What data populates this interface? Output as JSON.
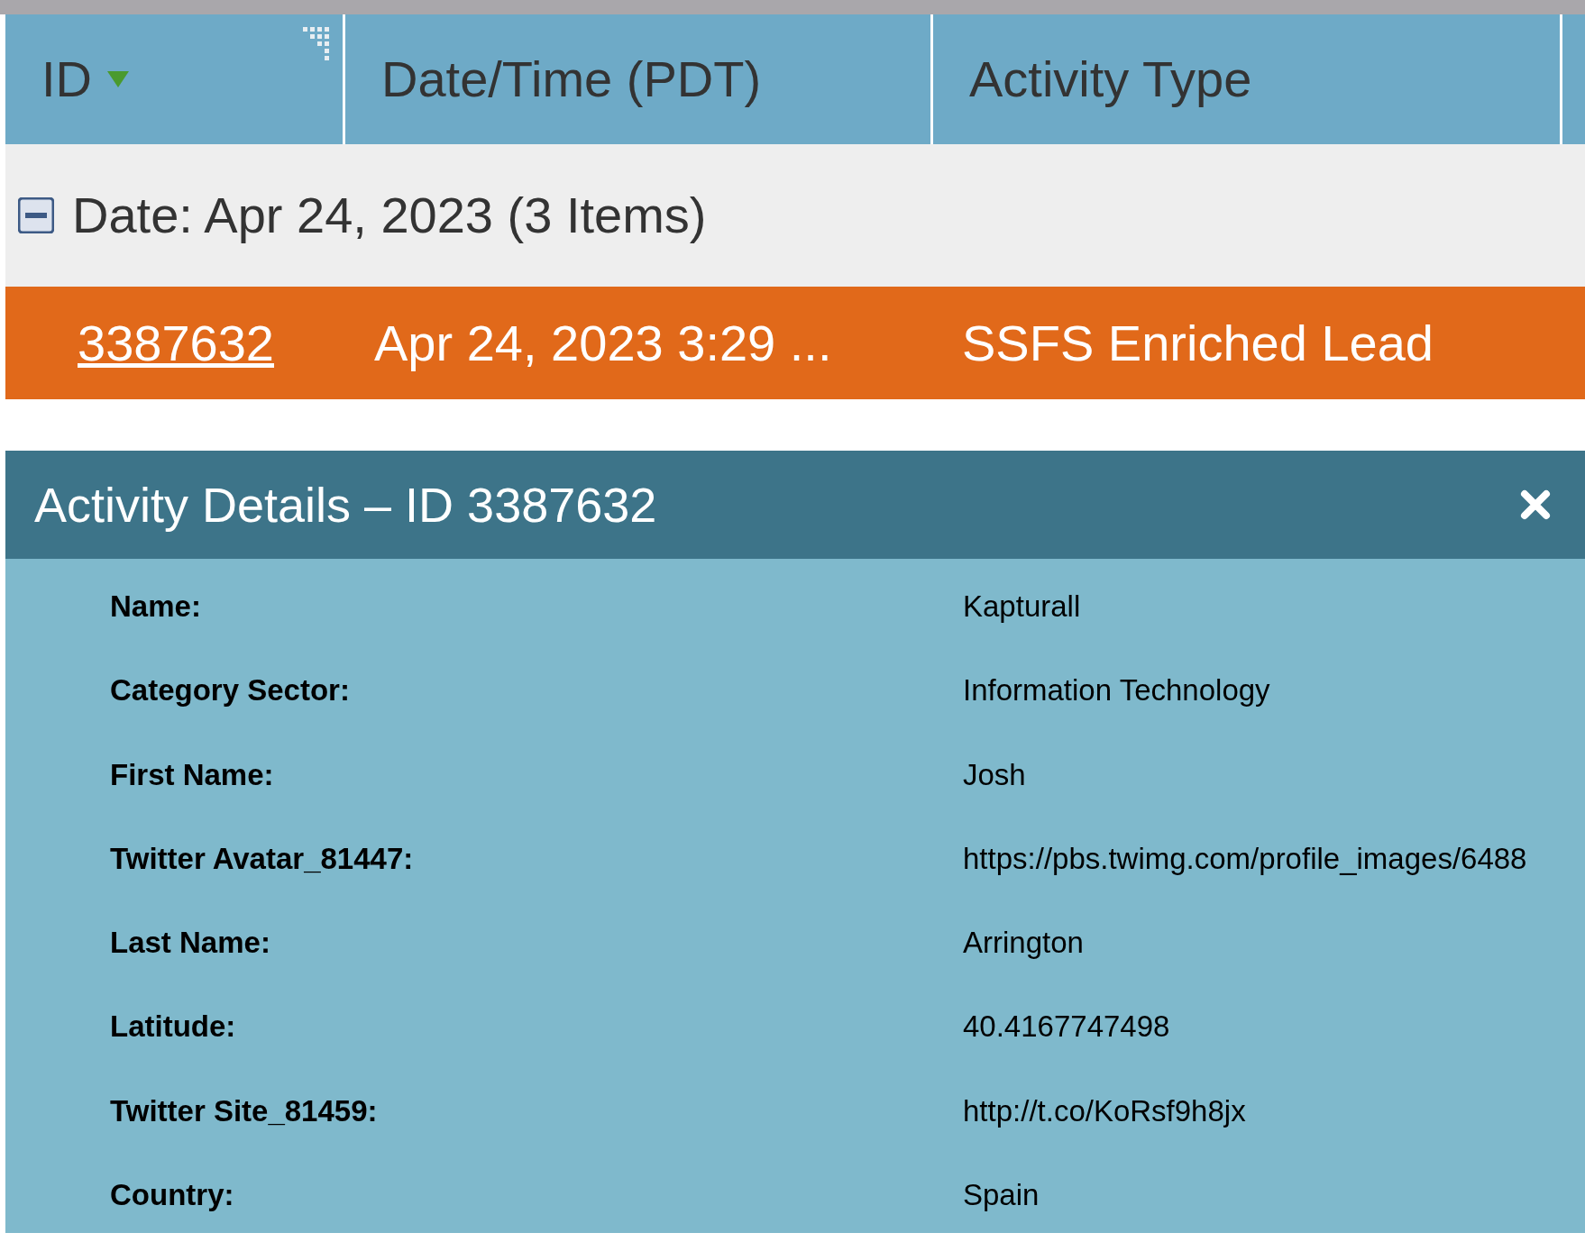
{
  "grid": {
    "columns": [
      {
        "label": "ID",
        "sorted": true,
        "menu": true
      },
      {
        "label": "Date/Time (PDT)",
        "sorted": false,
        "menu": false
      },
      {
        "label": "Activity Type",
        "sorted": false,
        "menu": false
      }
    ],
    "group": {
      "label": "Date: Apr 24, 2023 (3 Items)",
      "expanded": true
    },
    "rows": [
      {
        "selected": true,
        "cells": [
          "3387632",
          "Apr 24, 2023 3:29 ...",
          "SSFS Enriched Lead"
        ]
      }
    ]
  },
  "details": {
    "title": "Activity Details – ID 3387632",
    "fields": [
      {
        "label": "Name:",
        "value": "Kapturall"
      },
      {
        "label": "Category Sector:",
        "value": "Information Technology"
      },
      {
        "label": "First Name:",
        "value": "Josh"
      },
      {
        "label": "Twitter Avatar_81447:",
        "value": "https://pbs.twimg.com/profile_images/6488"
      },
      {
        "label": "Last Name:",
        "value": "Arrington"
      },
      {
        "label": "Latitude:",
        "value": "40.4167747498"
      },
      {
        "label": "Twitter Site_81459:",
        "value": "http://t.co/KoRsf9h8jx"
      },
      {
        "label": "Country:",
        "value": "Spain"
      }
    ]
  }
}
